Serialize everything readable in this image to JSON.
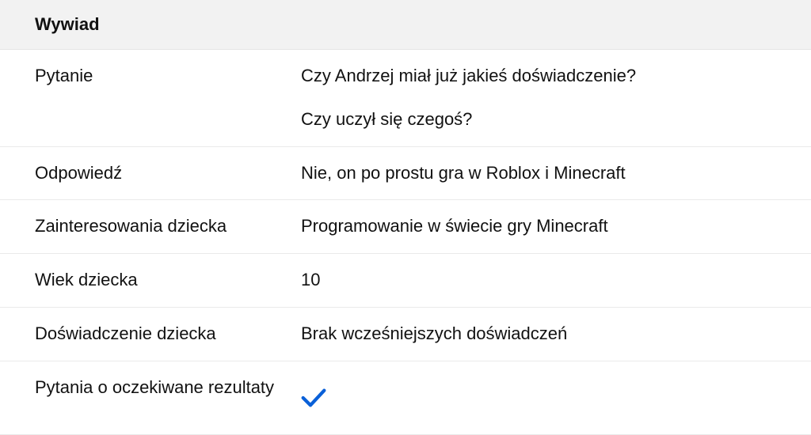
{
  "section": {
    "title": "Wywiad"
  },
  "rows": {
    "question": {
      "label": "Pytanie",
      "value_line1": "Czy Andrzej miał już jakieś doświadczenie?",
      "value_line2": "Czy uczył się czegoś?"
    },
    "answer": {
      "label": "Odpowiedź",
      "value": "Nie, on po prostu gra w Roblox i Minecraft"
    },
    "interests": {
      "label": "Zainteresowania dziecka",
      "value": "Programowanie w świecie gry Minecraft"
    },
    "age": {
      "label": "Wiek dziecka",
      "value": "10"
    },
    "experience": {
      "label": "Doświadczenie dziecka",
      "value": "Brak wcześniejszych doświadczeń"
    },
    "expected_results": {
      "label": "Pytania o oczekiwane rezultaty",
      "checked": true
    }
  },
  "colors": {
    "check": "#0a60d8"
  }
}
